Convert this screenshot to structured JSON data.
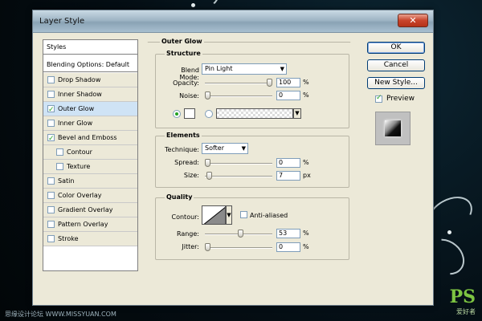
{
  "window": {
    "title": "Layer Style",
    "close_glyph": "✕"
  },
  "styles_list": {
    "items": [
      {
        "label": "Styles",
        "type": "header"
      },
      {
        "label": "Blending Options: Default",
        "type": "header"
      },
      {
        "label": "Drop Shadow",
        "checked": false
      },
      {
        "label": "Inner Shadow",
        "checked": false
      },
      {
        "label": "Outer Glow",
        "checked": true,
        "selected": true
      },
      {
        "label": "Inner Glow",
        "checked": false
      },
      {
        "label": "Bevel and Emboss",
        "checked": true
      },
      {
        "label": "Contour",
        "checked": false,
        "indent": true
      },
      {
        "label": "Texture",
        "checked": false,
        "indent": true
      },
      {
        "label": "Satin",
        "checked": false
      },
      {
        "label": "Color Overlay",
        "checked": false
      },
      {
        "label": "Gradient Overlay",
        "checked": false
      },
      {
        "label": "Pattern Overlay",
        "checked": false
      },
      {
        "label": "Stroke",
        "checked": false
      }
    ]
  },
  "buttons": {
    "ok": "OK",
    "cancel": "Cancel",
    "new_style": "New Style...",
    "preview": "Preview"
  },
  "preview_checked": true,
  "outer_glow": {
    "title": "Outer Glow",
    "structure": {
      "title": "Structure",
      "blend_mode_label": "Blend Mode:",
      "blend_mode_value": "Pin Light",
      "opacity_label": "Opacity:",
      "opacity_value": "100",
      "opacity_unit": "%",
      "opacity_level": 1.0,
      "noise_label": "Noise:",
      "noise_value": "0",
      "noise_unit": "%",
      "noise_level": 0.0,
      "color_radio_selected": true,
      "color": "#ffffff"
    },
    "elements": {
      "title": "Elements",
      "technique_label": "Technique:",
      "technique_value": "Softer",
      "spread_label": "Spread:",
      "spread_value": "0",
      "spread_unit": "%",
      "spread_level": 0.0,
      "size_label": "Size:",
      "size_value": "7",
      "size_unit": "px",
      "size_level": 0.03
    },
    "quality": {
      "title": "Quality",
      "contour_label": "Contour:",
      "anti_aliased_label": "Anti-aliased",
      "anti_aliased": false,
      "range_label": "Range:",
      "range_value": "53",
      "range_unit": "%",
      "range_level": 0.53,
      "jitter_label": "Jitter:",
      "jitter_value": "0",
      "jitter_unit": "%",
      "jitter_level": 0.0
    }
  },
  "watermarks": {
    "left": "思缘设计论坛 WWW.MISSYUAN.COM",
    "right": "PS",
    "right_sub": "爱好者"
  }
}
